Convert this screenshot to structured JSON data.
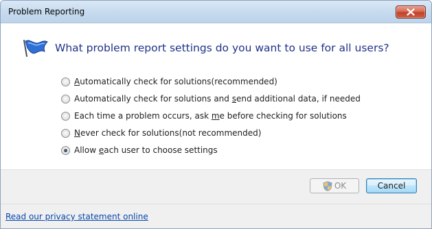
{
  "window": {
    "title": "Problem Reporting"
  },
  "header": {
    "question": "What problem report settings do you want to use for all users?"
  },
  "options": [
    {
      "pre": "",
      "key": "A",
      "post": "utomatically check for solutions(recommended)",
      "checked": false
    },
    {
      "pre": "Automatically check for solutions and ",
      "key": "s",
      "post": "end additional data, if needed",
      "checked": false
    },
    {
      "pre": "Each time a problem occurs, ask ",
      "key": "m",
      "post": "e before checking for solutions",
      "checked": false
    },
    {
      "pre": "",
      "key": "N",
      "post": "ever check for solutions(not recommended)",
      "checked": false
    },
    {
      "pre": "Allow ",
      "key": "e",
      "post": "ach user to choose settings",
      "checked": true
    }
  ],
  "buttons": {
    "ok_label": "OK",
    "cancel_label": "Cancel"
  },
  "footer": {
    "privacy_link": "Read our privacy statement online"
  },
  "colors": {
    "headline": "#1e3287",
    "link": "#0645ad"
  }
}
